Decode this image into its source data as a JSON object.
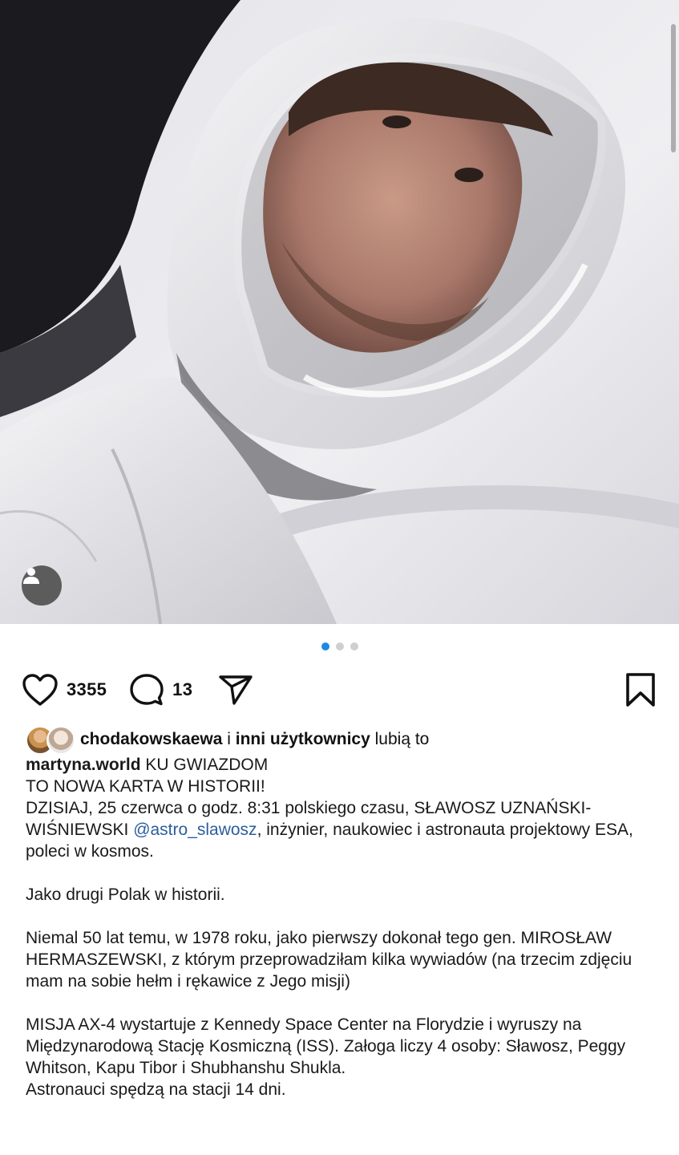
{
  "post": {
    "image": {
      "carousel_count": 3,
      "carousel_active_index": 0,
      "user_tag_icon": "person-icon"
    },
    "actions": {
      "likes_count": "3355",
      "comments_count": "13",
      "like_icon": "heart-icon",
      "comment_icon": "comment-icon",
      "share_icon": "send-icon",
      "save_icon": "bookmark-icon"
    },
    "liked_by": {
      "first_user": "chodakowskaewa",
      "conjunction": " i ",
      "others": "inni użytkownicy",
      "suffix": " lubią to"
    },
    "caption": {
      "author": "martyna.world",
      "line1_rest": " KU GWIAZDOM",
      "line2": "TO NOWA KARTA W HISTORII!",
      "p1_before": "DZISIAJ, 25 czerwca o godz. 8:31 polskiego czasu, SŁAWOSZ UZNAŃSKI-WIŚNIEWSKI ",
      "p1_mention": "@astro_slawosz",
      "p1_after": ", inżynier, naukowiec i astronauta projektowy ESA, poleci w kosmos.",
      "p2": "Jako drugi Polak w historii.",
      "p3": "Niemal 50 lat temu, w 1978 roku, jako pierwszy dokonał tego gen. MIROSŁAW HERMASZEWSKI, z którym przeprowadziłam kilka wywiadów (na trzecim zdjęciu mam na sobie hełm i rękawice z Jego misji)",
      "p4": "MISJA AX-4 wystartuje z Kennedy Space Center na Florydzie i wyruszy na Międzynarodową Stację Kosmiczną (ISS). Załoga liczy 4 osoby: Sławosz, Peggy Whitson, Kapu Tibor i Shubhanshu Shukla.",
      "p5": "Astronauci spędzą na stacji 14 dni."
    },
    "colors": {
      "accent_blue": "#1e88e5",
      "mention_blue": "#2b5d9e",
      "text": "#111111"
    }
  }
}
